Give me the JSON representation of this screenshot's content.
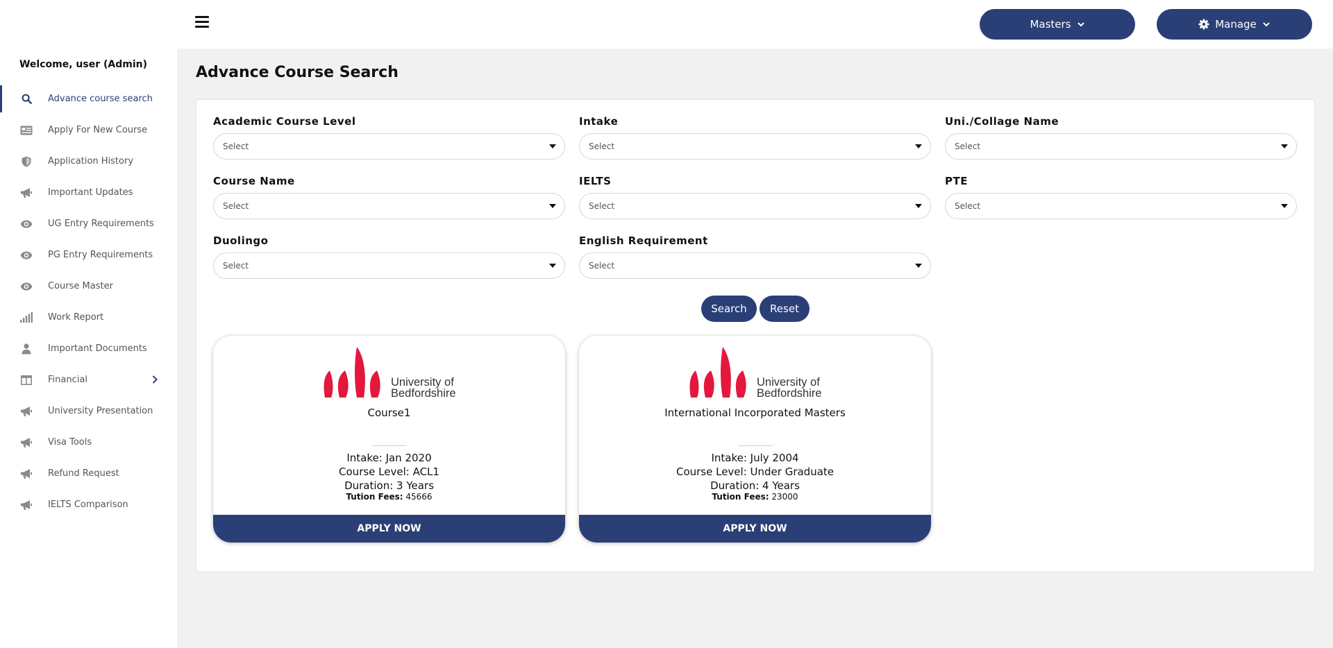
{
  "sidebar": {
    "welcome": "Welcome, user (Admin)",
    "items": [
      {
        "label": "Advance course search",
        "icon": "search-icon"
      },
      {
        "label": "Apply For New Course",
        "icon": "id-card-icon"
      },
      {
        "label": "Application History",
        "icon": "shield-icon"
      },
      {
        "label": "Important Updates",
        "icon": "megaphone-icon"
      },
      {
        "label": "UG Entry Requirements",
        "icon": "eye-icon"
      },
      {
        "label": "PG Entry Requirements",
        "icon": "eye-icon"
      },
      {
        "label": "Course Master",
        "icon": "eye-icon"
      },
      {
        "label": "Work Report",
        "icon": "signal-bars-icon"
      },
      {
        "label": "Important Documents",
        "icon": "user-icon"
      },
      {
        "label": "Financial",
        "icon": "table-icon"
      },
      {
        "label": "University Presentation",
        "icon": "megaphone-icon"
      },
      {
        "label": "Visa Tools",
        "icon": "megaphone-icon"
      },
      {
        "label": "Refund Request",
        "icon": "megaphone-icon"
      },
      {
        "label": "IELTS Comparison",
        "icon": "megaphone-icon"
      }
    ]
  },
  "header": {
    "masters_label": "Masters",
    "manage_label": "Manage"
  },
  "page": {
    "title": "Advance Course Search"
  },
  "filters": {
    "academic_course_level": {
      "label": "Academic Course Level",
      "value": "Select"
    },
    "intake": {
      "label": "Intake",
      "value": "Select"
    },
    "uni_name": {
      "label": "Uni./Collage Name",
      "value": "Select"
    },
    "course_name": {
      "label": "Course Name",
      "value": "Select"
    },
    "ielts": {
      "label": "IELTS",
      "value": "Select"
    },
    "pte": {
      "label": "PTE",
      "value": "Select"
    },
    "duolingo": {
      "label": "Duolingo",
      "value": "Select"
    },
    "english_requirement": {
      "label": "English Requirement",
      "value": "Select"
    }
  },
  "actions": {
    "search_label": "Search",
    "reset_label": "Reset"
  },
  "results": [
    {
      "university": "University of Bedfordshire",
      "logo_line1": "University of",
      "logo_line2": "Bedfordshire",
      "course": "Course1",
      "intake": "Intake: Jan 2020",
      "level": "Course Level: ACL1",
      "duration": "Duration: 3 Years",
      "fees_label": "Tution Fees:",
      "fees_value": "45666",
      "apply_label": "APPLY NOW"
    },
    {
      "university": "University of Bedfordshire",
      "logo_line1": "University of",
      "logo_line2": "Bedfordshire",
      "course": "International Incorporated Masters",
      "intake": "Intake: July 2004",
      "level": "Course Level: Under Graduate",
      "duration": "Duration: 4 Years",
      "fees_label": "Tution Fees:",
      "fees_value": "23000",
      "apply_label": "APPLY NOW"
    }
  ],
  "colors": {
    "primary": "#2b3f77",
    "logo_red": "#e4173e",
    "page_bg": "#f1f1f1"
  }
}
